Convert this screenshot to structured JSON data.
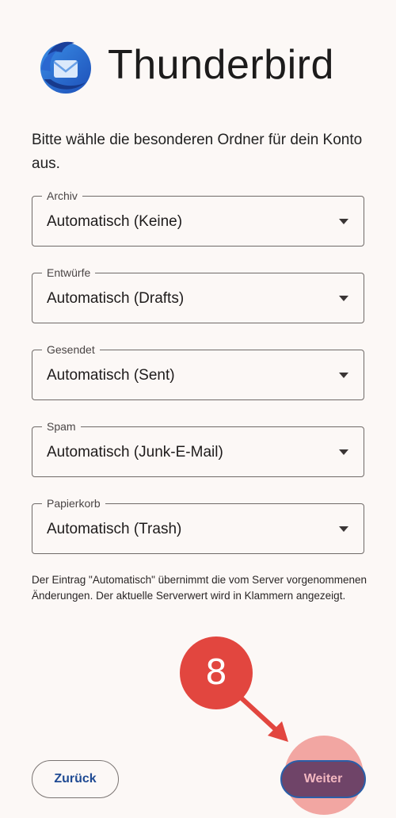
{
  "app": {
    "title": "Thunderbird",
    "logo_icon": "thunderbird-logo-icon"
  },
  "intro_text": "Bitte wähle die besonderen Ordner für dein Konto aus.",
  "folders": [
    {
      "label": "Archiv",
      "value": "Automatisch (Keine)"
    },
    {
      "label": "Entwürfe",
      "value": "Automatisch (Drafts)"
    },
    {
      "label": "Gesendet",
      "value": "Automatisch (Sent)"
    },
    {
      "label": "Spam",
      "value": "Automatisch (Junk-E-Mail)"
    },
    {
      "label": "Papierkorb",
      "value": "Automatisch (Trash)"
    }
  ],
  "note_text": "Der Eintrag \"Automatisch\" übernimmt die vom Server vorgenommenen Änderungen. Der aktuelle Serverwert wird in Klammern angezeigt.",
  "buttons": {
    "back_label": "Zurück",
    "next_label": "Weiter"
  },
  "annotation": {
    "step_number": "8"
  },
  "colors": {
    "background": "#fcf8f6",
    "primary_button": "#6f4468",
    "link_text": "#1f4a93",
    "annotation_red": "#e2463f",
    "highlight_pink": "#f2a6a2"
  }
}
